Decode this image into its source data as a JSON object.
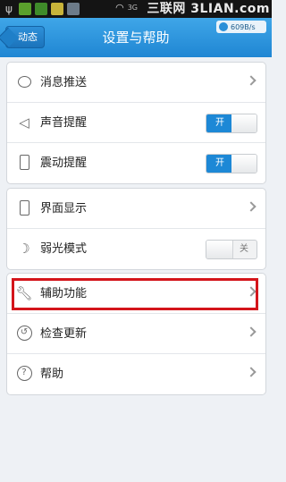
{
  "statusbar": {
    "watermark": "三联网 3LIAN.com",
    "network": "3G"
  },
  "header": {
    "back_label": "动态",
    "title": "设置与帮助",
    "speed": "609B/s"
  },
  "groups": [
    {
      "rows": [
        {
          "label": "消息推送",
          "icon": "message-bubble-icon"
        },
        {
          "label": "声音提醒",
          "icon": "speaker-icon",
          "toggle": "开"
        },
        {
          "label": "震动提醒",
          "icon": "vibrate-icon",
          "toggle": "开"
        }
      ]
    },
    {
      "rows": [
        {
          "label": "界面显示",
          "icon": "phone-icon"
        },
        {
          "label": "弱光模式",
          "icon": "moon-icon",
          "toggle": "关"
        }
      ]
    },
    {
      "rows": [
        {
          "label": "辅助功能",
          "icon": "wrench-icon"
        },
        {
          "label": "检查更新",
          "icon": "refresh-clock-icon"
        },
        {
          "label": "帮助",
          "icon": "question-icon"
        }
      ]
    }
  ],
  "colors": {
    "header_blue": "#1f86d3",
    "toggle_on": "#1d88d6",
    "highlight_red": "#d4151b"
  }
}
